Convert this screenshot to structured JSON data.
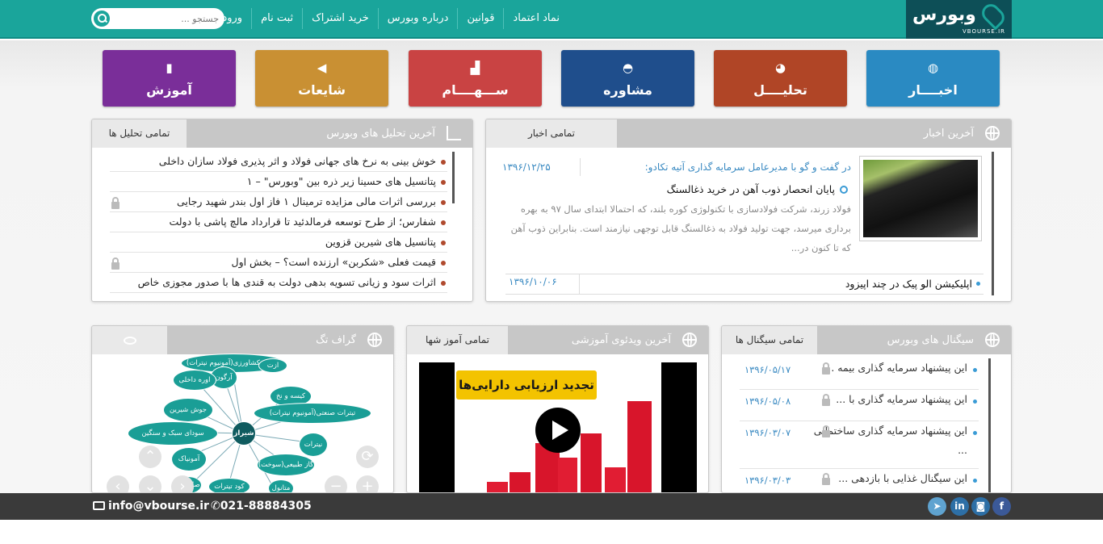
{
  "header": {
    "logo_text": "وبورس",
    "logo_domain": "VBOURSE.IR",
    "nav": [
      "نماد اعتماد",
      "قوانین",
      "درباره وبورس",
      "خرید اشتراک",
      "ثبت نام",
      "ورود"
    ],
    "search_placeholder": "جستجو ..."
  },
  "tiles": [
    {
      "label": "اخبــــار",
      "icon": "globe-icon",
      "color": "#2a8ac2"
    },
    {
      "label": "تحلیــــل",
      "icon": "pie-chart-icon",
      "color": "#b04526"
    },
    {
      "label": "مشاوره",
      "icon": "dashboard-icon",
      "color": "#1f4e8c"
    },
    {
      "label": "ســـهــــام",
      "icon": "bar-chart-icon",
      "color": "#c94343"
    },
    {
      "label": "شایعات",
      "icon": "speaker-icon",
      "color": "#c99033"
    },
    {
      "label": "آموزش",
      "icon": "book-icon",
      "color": "#7a2e99"
    }
  ],
  "news": {
    "title": "آخرین اخبار",
    "tab": "تمامی اخبار",
    "featured": {
      "kicker": "در گفت و گو با مدیرعامل سرمایه گذاری آتیه تکادو:",
      "date": "۱۳۹۶/۱۲/۲۵",
      "headline": "پایان انحصار ذوب آهن در خرید ذغالسنگ",
      "body": "فولاد زرند، شرکت فولادسازی با تکنولوژی کوره بلند، که احتمالا ابتدای سال ۹۷ به بهره برداری میرسد، جهت تولید فولاد به ذغالسنگ قابل توجهی نیازمند است. بنابراین ذوب آهن که تا کنون در..."
    },
    "second": {
      "title": "اپلیکیشن الو پیک در چند اپیزود",
      "date": "۱۳۹۶/۱۰/۰۶"
    }
  },
  "analysis": {
    "title": "آخرین تحلیل های وبورس",
    "tab": "تمامی تحلیل ها",
    "items": [
      {
        "text": "خوش بینی به نرخ های جهانی فولاد و اثر پذیری فولاد سازان داخلی",
        "locked": false
      },
      {
        "text": "پتانسیل های حسینا زیر ذره بین \"وبورس\" – ۱",
        "locked": false
      },
      {
        "text": "بررسی اثرات مالی مزایده ترمینال ۱ فاز اول بندر شهید رجایی",
        "locked": true
      },
      {
        "text": "شفارس؛ از طرح توسعه فرمالدئید تا قرارداد مالچ پاشی با دولت",
        "locked": false
      },
      {
        "text": "پتانسیل های شیرین قزوین",
        "locked": false
      },
      {
        "text": "قیمت فعلی «شکربن» ارزنده است؟ – بخش اول",
        "locked": true
      },
      {
        "text": "اثرات سود و زیانی تسویه بدهی دولت به قندی ها با صدور مجوزی خاص",
        "locked": false
      }
    ]
  },
  "signals": {
    "title": "سیگنال های وبورس",
    "tab": "تمامی سیگنال ها",
    "items": [
      {
        "text": "این پیشنهاد سرمایه گذاری بیمه ...",
        "date": "۱۳۹۶/۰۵/۱۷"
      },
      {
        "text": "این پیشنهاد سرمایه گذاری با ...",
        "date": "۱۳۹۶/۰۵/۰۸"
      },
      {
        "text": "این پیشنهاد سرمایه گذاری ساختمانی ...",
        "date": "۱۳۹۶/۰۳/۰۷"
      },
      {
        "text": "این سیگنال غذایی با بازدهی ...",
        "date": "۱۳۹۶/۰۳/۰۳"
      }
    ]
  },
  "videos": {
    "title": "آخرین ویدئوی آموزشی",
    "tab": "تمامی آموز شها",
    "banner": "تجدید ارزیابی دارایی‌ها"
  },
  "tag_graph": {
    "title": "گراف تگ",
    "center": "شیراز",
    "nodes": [
      "تیترات کشاورزی(آمونیوم نیترات)",
      "آرگون",
      "ازت",
      "اوره داخلی",
      "کیسه و نخ",
      "جوش شیرین",
      "تیترات صنعتی(آمونیوم نیترات)",
      "سودای سبک و سنگین",
      "نیترات",
      "گاز طبیعی(سوخت)",
      "آمونیاک",
      "صادراتی",
      "کود تیترات",
      "متانول"
    ]
  },
  "footer": {
    "email": "info@vbourse.ir",
    "phone": "021-88884305",
    "social": [
      "facebook-icon",
      "instagram-icon",
      "linkedin-icon",
      "telegram-icon"
    ]
  }
}
